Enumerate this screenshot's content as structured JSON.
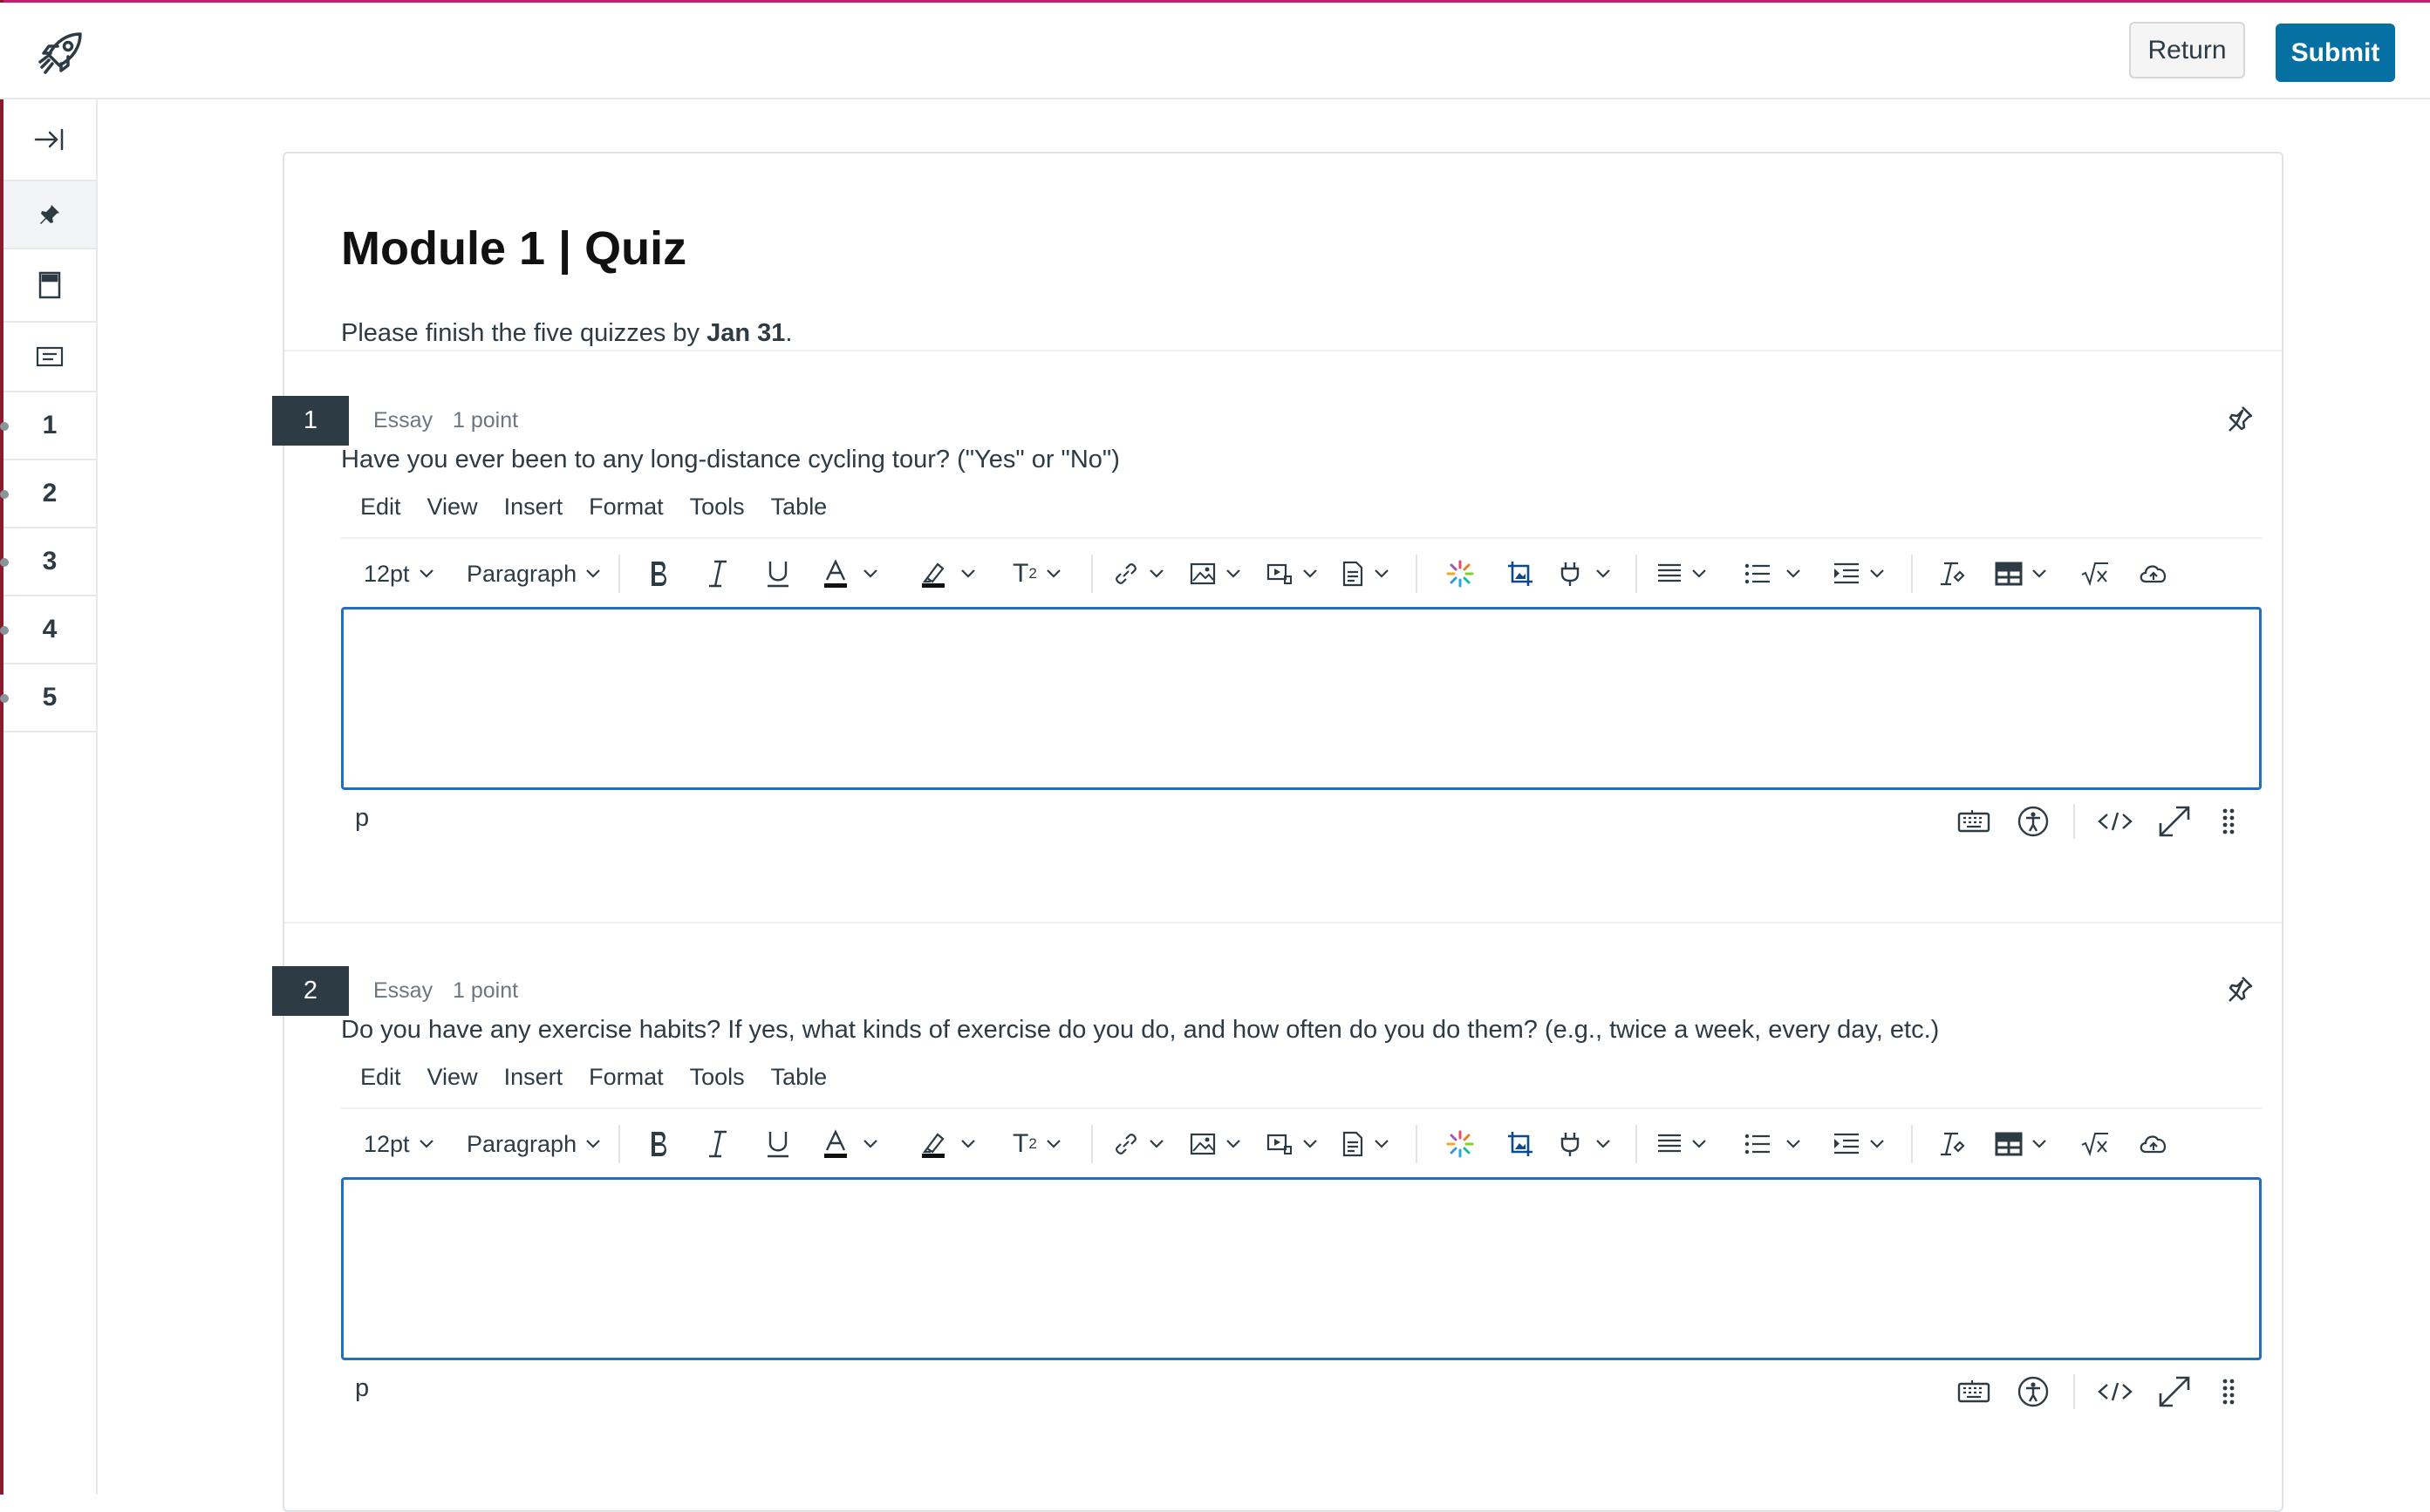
{
  "header": {
    "return_label": "Return",
    "submit_label": "Submit"
  },
  "rail": {
    "question_numbers": [
      "1",
      "2",
      "3",
      "4",
      "5"
    ]
  },
  "quiz": {
    "title": "Module 1 | Quiz",
    "intro_prefix": "Please finish the five quizzes by ",
    "intro_date": "Jan 31",
    "intro_suffix": "."
  },
  "questions": [
    {
      "number": "1",
      "type": "Essay",
      "points": "1 point",
      "text": "Have you ever been to any long-distance cycling tour? (\"Yes\" or \"No\")",
      "status_path": "p"
    },
    {
      "number": "2",
      "type": "Essay",
      "points": "1 point",
      "text": "Do you have any exercise habits? If yes, what kinds of exercise do you do, and how often do you do them? (e.g., twice a week, every day, etc.)",
      "status_path": "p"
    }
  ],
  "editor": {
    "menu": [
      "Edit",
      "View",
      "Insert",
      "Format",
      "Tools",
      "Table"
    ],
    "font_size": "12pt",
    "block_format": "Paragraph",
    "superscript_label": "T",
    "superscript_sup": "2"
  },
  "colors": {
    "brand": "#0770a3",
    "accent_top": "#c41e6e",
    "editor_focus": "#1f6fc5",
    "question_badge": "#2d3b45"
  },
  "icons": {
    "logo": "rocket-icon",
    "pin": "pin-icon",
    "collapse": "collapse-arrow-icon"
  }
}
